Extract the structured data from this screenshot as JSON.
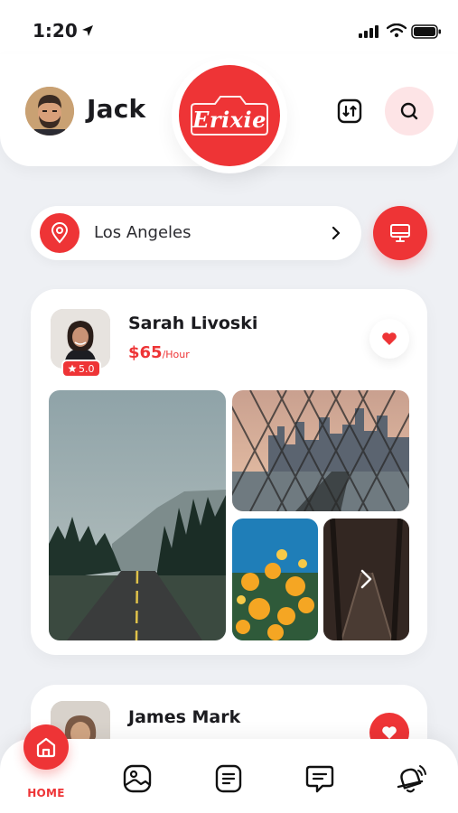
{
  "status_bar": {
    "time": "1:20"
  },
  "header": {
    "user_name": "Jack",
    "logo_text": "Erixie"
  },
  "location": {
    "city": "Los Angeles"
  },
  "cards": [
    {
      "name": "Sarah Livoski",
      "price": "$65",
      "unit": "/Hour",
      "rating": "5.0"
    },
    {
      "name": "James Mark"
    }
  ],
  "tabbar": {
    "home_label": "HOME",
    "icons": [
      "home-icon",
      "gallery-icon",
      "document-icon",
      "chat-icon",
      "notification-icon"
    ]
  },
  "colors": {
    "accent": "#ee3436",
    "accent_soft": "#fde4e6",
    "background": "#eef0f4"
  }
}
